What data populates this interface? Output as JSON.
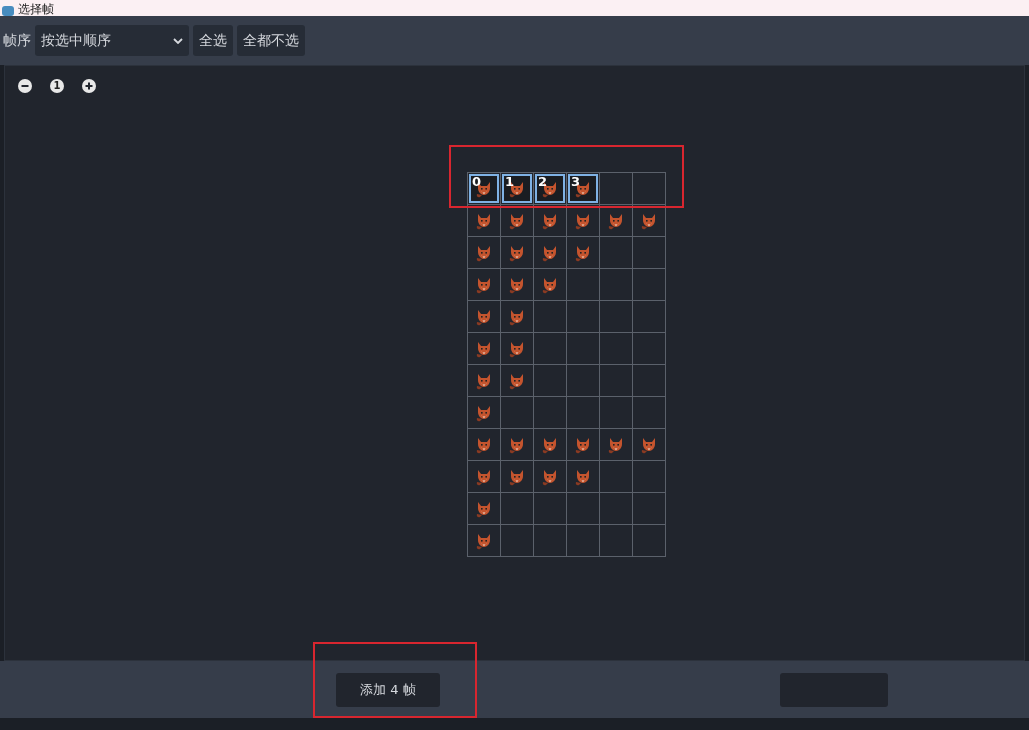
{
  "window": {
    "title": "选择帧"
  },
  "toolbar": {
    "order_label": "帧序",
    "order_select": {
      "value": "按选中顺序"
    },
    "buttons": [
      "全选",
      "全都不选"
    ]
  },
  "zoom": {
    "reset_label": "1"
  },
  "sprite_grid": {
    "rows": [
      {
        "highlighted": true,
        "frames": [
          {
            "selected": true,
            "label": "0"
          },
          {
            "selected": true,
            "label": "1"
          },
          {
            "selected": true,
            "label": "2"
          },
          {
            "selected": true,
            "label": "3"
          }
        ]
      },
      {
        "highlighted": false,
        "frames": [
          {
            "selected": false
          },
          {
            "selected": false
          },
          {
            "selected": false
          },
          {
            "selected": false
          },
          {
            "selected": false
          },
          {
            "selected": false
          }
        ]
      },
      {
        "highlighted": false,
        "frames": [
          {
            "selected": false
          },
          {
            "selected": false
          },
          {
            "selected": false
          },
          {
            "selected": false
          }
        ]
      },
      {
        "highlighted": false,
        "frames": [
          {
            "selected": false
          },
          {
            "selected": false
          },
          {
            "selected": false
          }
        ]
      },
      {
        "highlighted": false,
        "frames": [
          {
            "selected": false
          },
          {
            "selected": false
          }
        ]
      },
      {
        "highlighted": false,
        "frames": [
          {
            "selected": false
          },
          {
            "selected": false
          }
        ]
      },
      {
        "highlighted": false,
        "frames": [
          {
            "selected": false
          },
          {
            "selected": false
          }
        ]
      },
      {
        "highlighted": false,
        "frames": [
          {
            "selected": false
          }
        ]
      },
      {
        "highlighted": false,
        "frames": [
          {
            "selected": false
          },
          {
            "selected": false
          },
          {
            "selected": false
          },
          {
            "selected": false
          },
          {
            "selected": false
          },
          {
            "selected": false
          }
        ]
      },
      {
        "highlighted": false,
        "frames": [
          {
            "selected": false
          },
          {
            "selected": false
          },
          {
            "selected": false
          },
          {
            "selected": false
          }
        ]
      },
      {
        "highlighted": false,
        "frames": [
          {
            "selected": false
          }
        ]
      },
      {
        "highlighted": false,
        "frames": [
          {
            "selected": false
          }
        ]
      }
    ]
  },
  "footer": {
    "add_button": {
      "label": "添加 4 帧",
      "highlighted": true
    }
  }
}
